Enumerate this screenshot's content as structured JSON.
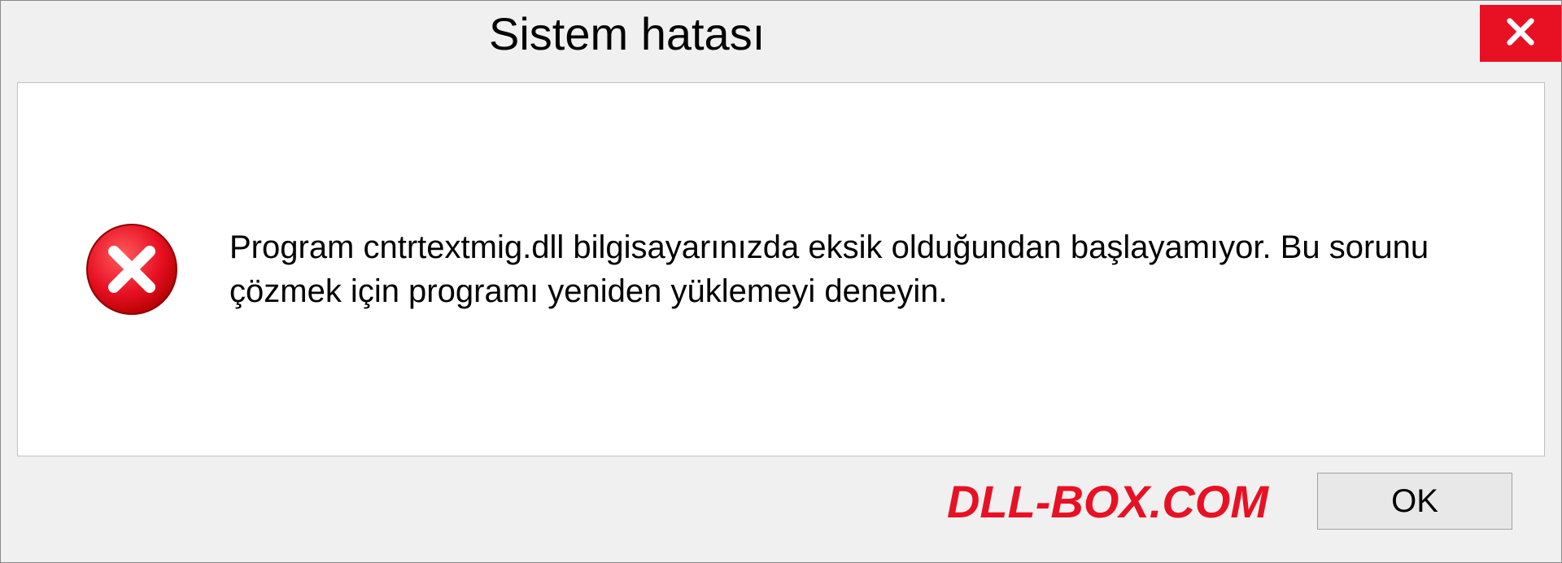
{
  "titlebar": {
    "title": "Sistem hatası"
  },
  "message": {
    "text": "Program cntrtextmig.dll bilgisayarınızda eksik olduğundan başlayamıyor. Bu sorunu çözmek için programı yeniden yüklemeyi deneyin."
  },
  "footer": {
    "watermark": "DLL-BOX.COM",
    "ok_label": "OK"
  },
  "colors": {
    "accent_red": "#e81123",
    "background": "#f0f0f0",
    "panel_white": "#ffffff"
  }
}
